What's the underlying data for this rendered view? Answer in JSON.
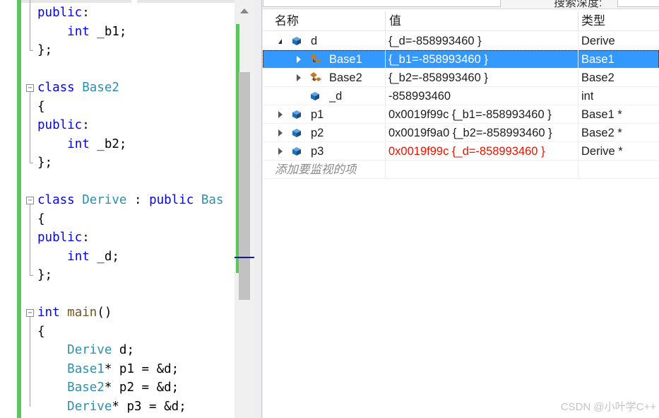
{
  "editor": {
    "lines": [
      {
        "tokens": [
          {
            "t": "public",
            "c": "kw"
          },
          {
            "t": ":",
            "c": ""
          }
        ]
      },
      {
        "tokens": [
          {
            "t": "    ",
            "c": ""
          },
          {
            "t": "int",
            "c": "kw"
          },
          {
            "t": " _b1;",
            "c": ""
          }
        ]
      },
      {
        "tokens": [
          {
            "t": "};",
            "c": ""
          }
        ]
      },
      {
        "tokens": []
      },
      {
        "tokens": [
          {
            "t": "class",
            "c": "kw"
          },
          {
            "t": " ",
            "c": ""
          },
          {
            "t": "Base2",
            "c": "ty"
          }
        ]
      },
      {
        "tokens": [
          {
            "t": "{",
            "c": ""
          }
        ]
      },
      {
        "tokens": [
          {
            "t": "public",
            "c": "kw"
          },
          {
            "t": ":",
            "c": ""
          }
        ]
      },
      {
        "tokens": [
          {
            "t": "    ",
            "c": ""
          },
          {
            "t": "int",
            "c": "kw"
          },
          {
            "t": " _b2;",
            "c": ""
          }
        ]
      },
      {
        "tokens": [
          {
            "t": "};",
            "c": ""
          }
        ]
      },
      {
        "tokens": []
      },
      {
        "tokens": [
          {
            "t": "class",
            "c": "kw"
          },
          {
            "t": " ",
            "c": ""
          },
          {
            "t": "Derive",
            "c": "ty"
          },
          {
            "t": " : ",
            "c": ""
          },
          {
            "t": "public",
            "c": "kw"
          },
          {
            "t": " ",
            "c": ""
          },
          {
            "t": "Bas",
            "c": "ty"
          }
        ]
      },
      {
        "tokens": [
          {
            "t": "{",
            "c": ""
          }
        ]
      },
      {
        "tokens": [
          {
            "t": "public",
            "c": "kw"
          },
          {
            "t": ":",
            "c": ""
          }
        ]
      },
      {
        "tokens": [
          {
            "t": "    ",
            "c": ""
          },
          {
            "t": "int",
            "c": "kw"
          },
          {
            "t": " _d;",
            "c": ""
          }
        ]
      },
      {
        "tokens": [
          {
            "t": "};",
            "c": ""
          }
        ]
      },
      {
        "tokens": []
      },
      {
        "tokens": [
          {
            "t": "int",
            "c": "kw"
          },
          {
            "t": " ",
            "c": ""
          },
          {
            "t": "main",
            "c": "fn"
          },
          {
            "t": "()",
            "c": ""
          }
        ]
      },
      {
        "tokens": [
          {
            "t": "{",
            "c": ""
          }
        ]
      },
      {
        "tokens": [
          {
            "t": "    ",
            "c": ""
          },
          {
            "t": "Derive",
            "c": "ty"
          },
          {
            "t": " d;",
            "c": ""
          }
        ]
      },
      {
        "tokens": [
          {
            "t": "    ",
            "c": ""
          },
          {
            "t": "Base1",
            "c": "ty"
          },
          {
            "t": "* p1 = &d;",
            "c": ""
          }
        ]
      },
      {
        "tokens": [
          {
            "t": "    ",
            "c": ""
          },
          {
            "t": "Base2",
            "c": "ty"
          },
          {
            "t": "* p2 = &d;",
            "c": ""
          }
        ]
      },
      {
        "tokens": [
          {
            "t": "    ",
            "c": ""
          },
          {
            "t": "Derive",
            "c": "ty"
          },
          {
            "t": "* p3 = &d;",
            "c": ""
          }
        ]
      }
    ],
    "fold_markers": [
      {
        "line": 4,
        "symbol": "−"
      },
      {
        "line": 10,
        "symbol": "−"
      },
      {
        "line": 16,
        "symbol": "−"
      }
    ],
    "colors": {
      "keyword": "#0000ff",
      "type": "#2b91af",
      "function": "#74531f",
      "change_bar": "#5dc55d"
    }
  },
  "watch": {
    "toolbar": {
      "search_label": "搜索深度:",
      "search_value": ""
    },
    "columns": {
      "name": "名称",
      "value": "值",
      "type": "类型"
    },
    "rows": [
      {
        "name": "d",
        "value": "{_d=-858993460 }",
        "type": "Derive",
        "level": 0,
        "expander": "open",
        "icon": "object-icon",
        "selected": false,
        "changed": false
      },
      {
        "name": "Base1",
        "value": "{_b1=-858993460 }",
        "type": "Base1",
        "level": 1,
        "expander": "closed",
        "icon": "base-class-icon",
        "selected": true,
        "changed": false
      },
      {
        "name": "Base2",
        "value": "{_b2=-858993460 }",
        "type": "Base2",
        "level": 1,
        "expander": "closed",
        "icon": "base-class-icon",
        "selected": false,
        "changed": false
      },
      {
        "name": "_d",
        "value": "-858993460",
        "type": "int",
        "level": 1,
        "expander": "none",
        "icon": "field-icon",
        "selected": false,
        "changed": false
      },
      {
        "name": "p1",
        "value": "0x0019f99c {_b1=-858993460 }",
        "type": "Base1 *",
        "level": 0,
        "expander": "closed",
        "icon": "object-icon",
        "selected": false,
        "changed": false
      },
      {
        "name": "p2",
        "value": "0x0019f9a0 {_b2=-858993460 }",
        "type": "Base2 *",
        "level": 0,
        "expander": "closed",
        "icon": "object-icon",
        "selected": false,
        "changed": false
      },
      {
        "name": "p3",
        "value": "0x0019f99c {_d=-858993460 }",
        "type": "Derive *",
        "level": 0,
        "expander": "closed",
        "icon": "object-icon",
        "selected": false,
        "changed": true
      }
    ],
    "add_watch_placeholder": "添加要监视的项",
    "colors": {
      "selection": "#3399ff",
      "changed_value": "#e51400",
      "icon_blue": "#1f6fb5",
      "icon_orange": "#c27a28"
    }
  },
  "watermark": "CSDN @小叶学C++"
}
